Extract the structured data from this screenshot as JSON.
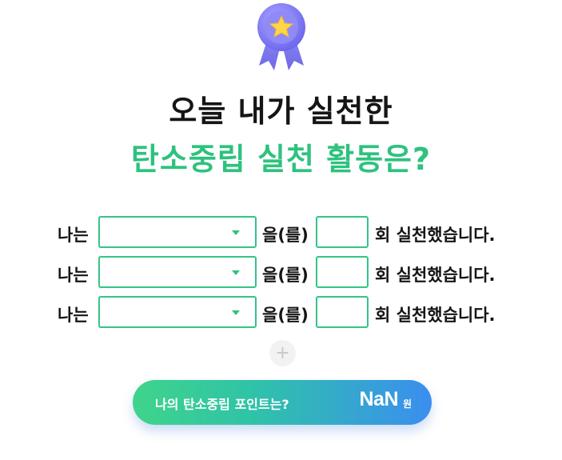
{
  "header": {
    "title_line1": "오늘 내가 실천한",
    "title_line2": "탄소중립 실천 활동은?"
  },
  "colors": {
    "accent_green": "#2ec27e",
    "border_green": "#35c486",
    "gradient_start": "#3fd48a",
    "gradient_end": "#3a8ef0"
  },
  "rows": [
    {
      "prefix": "나는",
      "select_value": "",
      "particle": "을(를)",
      "count_value": "",
      "suffix": "회 실천했습니다."
    },
    {
      "prefix": "나는",
      "select_value": "",
      "particle": "을(를)",
      "count_value": "",
      "suffix": "회 실천했습니다."
    },
    {
      "prefix": "나는",
      "select_value": "",
      "particle": "을(를)",
      "count_value": "",
      "suffix": "회 실천했습니다."
    }
  ],
  "add_button": {
    "icon": "plus-icon",
    "label": "+"
  },
  "result": {
    "question": "나의 탄소중립 포인트는?",
    "value": "NaN",
    "unit": "원"
  }
}
